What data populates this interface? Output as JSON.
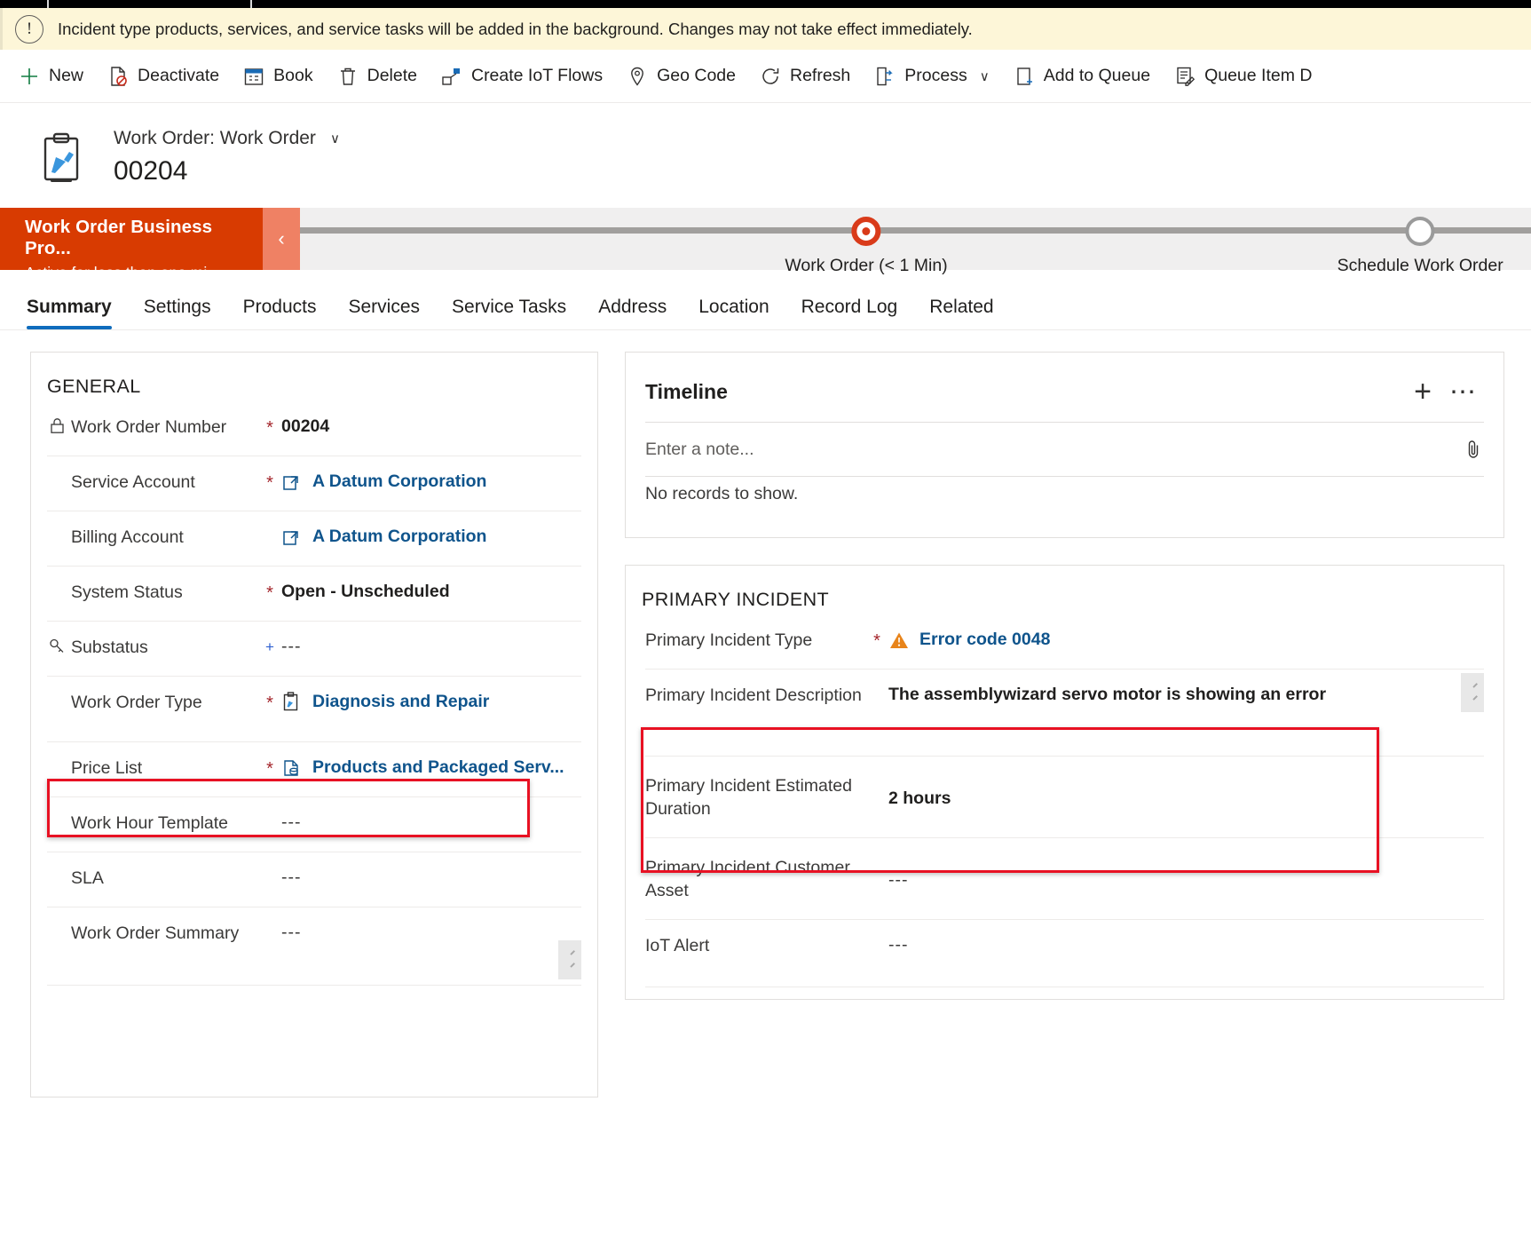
{
  "notification": {
    "icon": "info-circle-icon",
    "text": "Incident type products, services, and service tasks will be added in the background. Changes may not take effect immediately."
  },
  "command_bar": {
    "items": [
      {
        "label": "New",
        "icon": "plus-icon"
      },
      {
        "label": "Deactivate",
        "icon": "deactivate-icon"
      },
      {
        "label": "Book",
        "icon": "calendar-icon"
      },
      {
        "label": "Delete",
        "icon": "trash-icon"
      },
      {
        "label": "Create IoT Flows",
        "icon": "iot-flow-icon"
      },
      {
        "label": "Geo Code",
        "icon": "map-pin-icon"
      },
      {
        "label": "Refresh",
        "icon": "refresh-icon"
      },
      {
        "label": "Process",
        "icon": "process-icon",
        "chevron": "∨"
      },
      {
        "label": "Add to Queue",
        "icon": "add-to-queue-icon"
      },
      {
        "label": "Queue Item D",
        "icon": "queue-item-icon"
      }
    ]
  },
  "record_header": {
    "icon": "work-order-clipboard-icon",
    "entity_label": "Work Order: Work Order",
    "dropdown_glyph": "∨",
    "record_name": "00204"
  },
  "business_process": {
    "stage_name": "Work Order Business Pro...",
    "stage_status": "Active for less than one mi...",
    "collapse_glyph": "‹",
    "steps": [
      {
        "label": "Work Order  (< 1 Min)",
        "state": "active"
      },
      {
        "label": "Schedule Work Order",
        "state": "pending"
      }
    ]
  },
  "tabs": [
    {
      "label": "Summary",
      "active": true
    },
    {
      "label": "Settings",
      "active": false
    },
    {
      "label": "Products",
      "active": false
    },
    {
      "label": "Services",
      "active": false
    },
    {
      "label": "Service Tasks",
      "active": false
    },
    {
      "label": "Address",
      "active": false
    },
    {
      "label": "Location",
      "active": false
    },
    {
      "label": "Record Log",
      "active": false
    },
    {
      "label": "Related",
      "active": false
    }
  ],
  "general_section": {
    "title": "GENERAL",
    "fields": [
      {
        "label": "Work Order Number",
        "required": "*",
        "value": "00204",
        "value_style": "bold",
        "label_icon": "lock-icon"
      },
      {
        "label": "Service Account",
        "required": "*",
        "value": "A Datum Corporation",
        "value_style": "link",
        "value_icon": "account-lookup-icon"
      },
      {
        "label": "Billing Account",
        "required": "",
        "value": "A Datum Corporation",
        "value_style": "link",
        "value_icon": "account-lookup-icon"
      },
      {
        "label": "System Status",
        "required": "*",
        "value": "Open - Unscheduled",
        "value_style": "bold"
      },
      {
        "label": "Substatus",
        "required": "+",
        "value": "---",
        "value_style": "dash",
        "label_icon": "key-icon"
      },
      {
        "label": "Work Order Type",
        "required": "*",
        "value": "Diagnosis and Repair",
        "value_style": "link",
        "value_icon": "work-order-type-icon",
        "highlighted": true
      },
      {
        "label": "Price List",
        "required": "*",
        "value": "Products and Packaged Serv...",
        "value_style": "link",
        "value_icon": "price-list-icon"
      },
      {
        "label": "Work Hour Template",
        "required": "",
        "value": "---",
        "value_style": "dash"
      },
      {
        "label": "SLA",
        "required": "",
        "value": "---",
        "value_style": "dash"
      },
      {
        "label": "Work Order Summary",
        "required": "",
        "value": "---",
        "value_style": "dash",
        "resizable": true
      }
    ]
  },
  "timeline": {
    "title": "Timeline",
    "add_icon": "plus-icon",
    "more_icon": "ellipsis-icon",
    "note_placeholder": "Enter a note...",
    "attach_icon": "paperclip-icon",
    "empty_text": "No records to show."
  },
  "primary_incident": {
    "title": "PRIMARY INCIDENT",
    "fields": [
      {
        "label": "Primary Incident Type",
        "required": "*",
        "value": "Error code 0048",
        "value_style": "link",
        "value_icon": "warning-triangle-icon"
      },
      {
        "label": "Primary Incident Description",
        "required": "",
        "value": "The assemblywizard servo motor is showing an error",
        "value_style": "bold",
        "resizable": true,
        "highlighted": true
      },
      {
        "label": "Primary Incident Estimated Duration",
        "required": "",
        "value": "2 hours",
        "value_style": "bold",
        "highlighted": true
      },
      {
        "label": "Primary Incident Customer Asset",
        "required": "",
        "value": "---",
        "value_style": "dash"
      },
      {
        "label": "IoT Alert",
        "required": "",
        "value": "---",
        "value_style": "dash"
      }
    ]
  },
  "colors": {
    "accent_link": "#0f548c",
    "required_red": "#a4262c",
    "bpf_orange": "#d83b01",
    "active_tab_blue": "#0f6cbd",
    "highlight_red": "#e81123",
    "notification_bg": "#fdf6d8",
    "warning_orange": "#e8841a"
  }
}
